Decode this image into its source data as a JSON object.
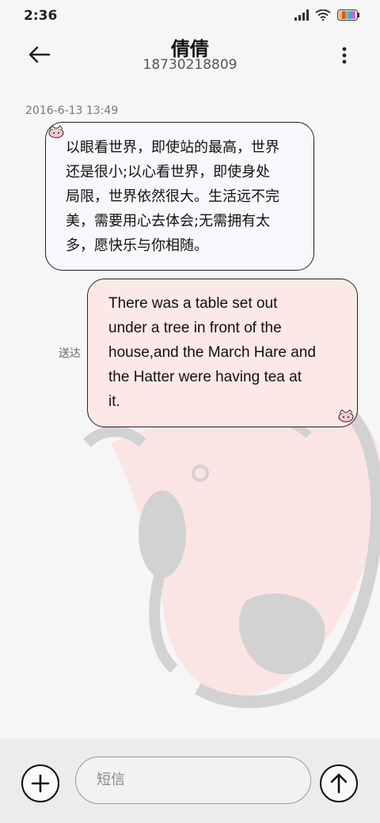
{
  "status_bar": {
    "time": "2:36",
    "icons": [
      "signal-icon",
      "wifi-icon",
      "battery-icon"
    ]
  },
  "header": {
    "contact_name": "倩倩",
    "contact_number": "18730218809",
    "back_icon": "back-arrow-icon",
    "more_icon": "more-vertical-icon"
  },
  "conversation": {
    "timestamp": "2016-6-13 13:49",
    "messages": [
      {
        "direction": "incoming",
        "lines": [
          "以眼看世界，即使站的最高，世界",
          "还是很小;以心看世界，即使身处",
          "局限，世界依然很大。生活远不完",
          "美，需要用心去体会;无需拥有太",
          "多，愿快乐与你相随。"
        ]
      },
      {
        "direction": "outgoing",
        "lines": [
          "There was a table set out",
          "under a tree in front of the",
          "house,and the March Hare and",
          "the Hatter were having tea at",
          "it."
        ],
        "status": "送达"
      }
    ]
  },
  "composer": {
    "placeholder": "短信",
    "add_icon": "plus-icon",
    "send_icon": "send-arrow-icon"
  },
  "colors": {
    "background": "#f6f6f6",
    "incoming_bubble": "#f8f8fc",
    "outgoing_bubble": "#fde8e8",
    "watermark_pink": "#fbe4e4",
    "watermark_gray": "#d2d2d2"
  }
}
